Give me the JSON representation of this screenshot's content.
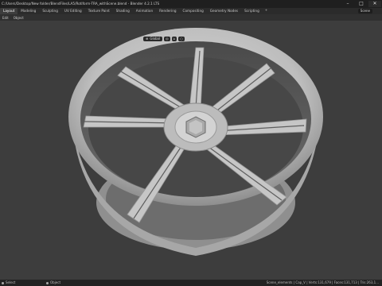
{
  "window": {
    "title": "C:/Users/Desktop/New folder/BlendFiles/LA5/Rotiform-TRA_withScene.blend - Blender 4.2.1 LTS"
  },
  "menubar": {
    "tabs": [
      "Layout",
      "Modeling",
      "Sculpting",
      "UV Editing",
      "Texture Paint",
      "Shading",
      "Animation",
      "Rendering",
      "Compositing",
      "Geometry Nodes",
      "Scripting"
    ],
    "active_tab": "Layout",
    "add_tab_label": "+",
    "scene_label": "Scene"
  },
  "modebar": {
    "items": [
      "Edit",
      "Object"
    ]
  },
  "viewport_header": {
    "orientation_label": "Global"
  },
  "statusbar": {
    "left_a": "Select",
    "left_b": "Pan View",
    "left_c": "Object",
    "right": "Scene_elements | Cap_V | Verts:131,679 | Faces:131,713 | Tris:263,1..."
  },
  "colors": {
    "background": "#3d3d3d",
    "titlebar": "#1f1f1f",
    "menubar": "#2b2b2b",
    "wheel_light": "#cfcfcf",
    "wheel_dark": "#5a5a5a"
  }
}
